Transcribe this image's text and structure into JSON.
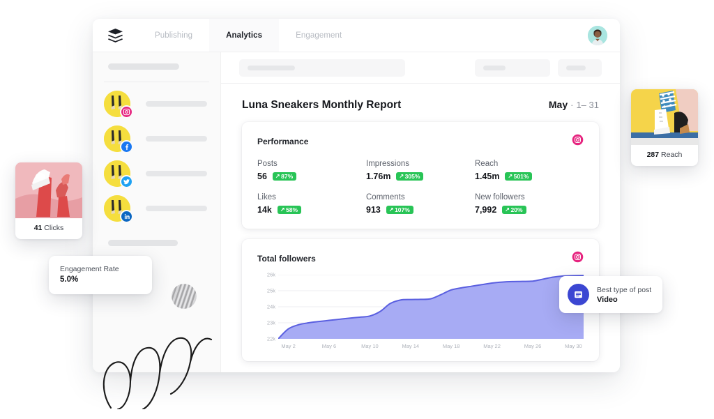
{
  "app": {
    "logo_icon": "layers-stack-icon",
    "tabs": [
      {
        "label": "Publishing",
        "active": false
      },
      {
        "label": "Analytics",
        "active": true
      },
      {
        "label": "Engagement",
        "active": false
      }
    ],
    "avatar_icon": "user-avatar"
  },
  "sidebar": {
    "accounts": [
      {
        "network": "instagram",
        "badge_icon": "instagram-icon"
      },
      {
        "network": "facebook",
        "badge_icon": "facebook-icon"
      },
      {
        "network": "twitter",
        "badge_icon": "twitter-icon"
      },
      {
        "network": "linkedin",
        "badge_icon": "linkedin-icon"
      }
    ]
  },
  "report": {
    "title": "Luna Sneakers Monthly Report",
    "month": "May",
    "separator": "·",
    "day_range": "1– 31"
  },
  "performance": {
    "title": "Performance",
    "network_icon": "instagram-icon",
    "metrics": [
      {
        "label": "Posts",
        "value": "56",
        "delta": "87%",
        "trend": "up"
      },
      {
        "label": "Impressions",
        "value": "1.76m",
        "delta": "305%",
        "trend": "up"
      },
      {
        "label": "Reach",
        "value": "1.45m",
        "delta": "501%",
        "trend": "up"
      },
      {
        "label": "Likes",
        "value": "14k",
        "delta": "58%",
        "trend": "up"
      },
      {
        "label": "Comments",
        "value": "913",
        "delta": "107%",
        "trend": "up"
      },
      {
        "label": "New followers",
        "value": "7,992",
        "delta": "20%",
        "trend": "up"
      }
    ]
  },
  "followers_card": {
    "title": "Total followers",
    "network_icon": "instagram-icon"
  },
  "chart_data": {
    "type": "area",
    "title": "Total followers",
    "xlabel": "",
    "ylabel": "",
    "ylim": [
      22000,
      26000
    ],
    "yticks": [
      22000,
      23000,
      24000,
      25000,
      26000
    ],
    "ytick_labels": [
      "22k",
      "23k",
      "24k",
      "25k",
      "26k"
    ],
    "xtick_labels": [
      "May 2",
      "May 6",
      "May 10",
      "May 14",
      "May 18",
      "May 22",
      "May 26",
      "May 30"
    ],
    "xtick_positions": [
      2,
      6,
      10,
      14,
      18,
      22,
      26,
      30
    ],
    "grid": true,
    "legend": "none",
    "line_color": "#5a5fe0",
    "fill_color": "#a7abf4",
    "series": [
      {
        "name": "Total followers",
        "x": [
          1,
          2,
          3,
          4,
          5,
          6,
          7,
          8,
          9,
          10,
          11,
          12,
          13,
          14,
          15,
          16,
          17,
          18,
          19,
          20,
          21,
          22,
          23,
          24,
          25,
          26,
          27,
          28,
          29,
          30,
          31
        ],
        "values": [
          22000,
          22620,
          22880,
          23000,
          23080,
          23150,
          23220,
          23290,
          23350,
          23420,
          23700,
          24200,
          24420,
          24450,
          24460,
          24500,
          24760,
          25050,
          25180,
          25280,
          25380,
          25480,
          25540,
          25570,
          25580,
          25600,
          25720,
          25850,
          25920,
          25940,
          25950
        ]
      }
    ]
  },
  "floating": {
    "clicks": {
      "value": "41",
      "label": "Clicks",
      "thumb_icon": "pink-sneaker-photo"
    },
    "reach": {
      "value": "287",
      "label": "Reach",
      "thumb_icon": "yellow-sneaker-photo"
    },
    "engagement": {
      "title": "Engagement Rate",
      "value": "5.0%"
    },
    "best_post": {
      "title": "Best type of post",
      "value": "Video",
      "icon": "video-post-icon"
    }
  },
  "colors": {
    "accent_green": "#28c456",
    "chart_line": "#5a5fe0",
    "chart_fill": "#a7abf4",
    "instagram": "#e6247f",
    "facebook": "#1877f2",
    "twitter": "#1da1f2",
    "linkedin": "#0a66c2",
    "best_post_blue": "#3b46d2"
  }
}
